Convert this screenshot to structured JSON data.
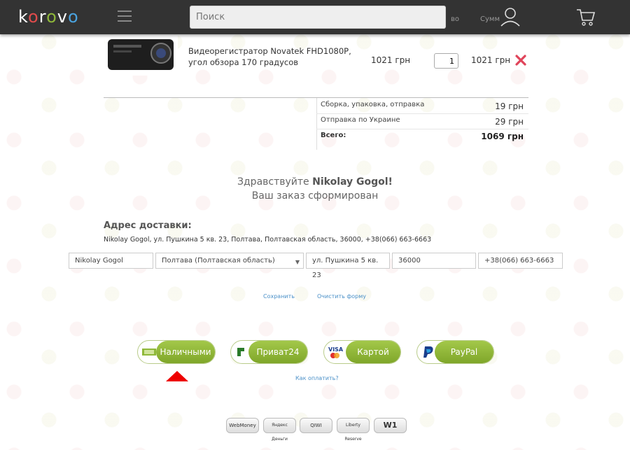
{
  "header": {
    "logo": {
      "k": "k",
      "o1": "o",
      "r": "r",
      "o2": "o",
      "v": "v",
      "o3": "o"
    },
    "search_placeholder": "Поиск",
    "col_qty": "во",
    "col_sum": "Сумм"
  },
  "product": {
    "name": "Видеорегистратор Novatek FHD1080P, угол обзора 170 градусов",
    "price": "1021 грн",
    "qty": "1",
    "sum": "1021 грн"
  },
  "summary": {
    "rows": [
      {
        "label": "Сборка, упаковка, отправка",
        "value": "19 грн"
      },
      {
        "label": "Отправка по Украине",
        "value": "29 грн"
      }
    ],
    "total_label": "Всего:",
    "total_value": "1069 грн"
  },
  "greeting": {
    "hello": "Здравствуйте",
    "name": "Nikolay Gogol!",
    "order_done": "Ваш заказ сформирован"
  },
  "address": {
    "title": "Адрес доставки:",
    "text": "Nikolay Gogol, ул. Пушкина 5 кв. 23, Полтава, Полтавская область, 36000, +38(066) 663-6663",
    "fields": {
      "name": "Nikolay Gogol",
      "region": "Полтава (Полтавская область)",
      "street": "ул. Пушкина 5 кв. 23",
      "zip": "36000",
      "phone": "+38(066) 663-6663"
    },
    "save": "Сохранить",
    "clear": "Очистить форму"
  },
  "payment": {
    "options": [
      {
        "label": "Наличными"
      },
      {
        "label": "Приват24"
      },
      {
        "label": "Картой"
      },
      {
        "label": "PayPal"
      }
    ],
    "how_to_pay": "Как оплатить?",
    "selected_index": 0
  },
  "badges": [
    "WebMoney",
    "Яндекс Деньги",
    "QIWI",
    "Liberty Reserve",
    "W1"
  ],
  "colors": {
    "header_bg": "#333333",
    "accent_green": "#8fb83a",
    "remove_red": "#e0445a",
    "link_blue": "#4a90c8",
    "marker_red": "#ee0000"
  }
}
